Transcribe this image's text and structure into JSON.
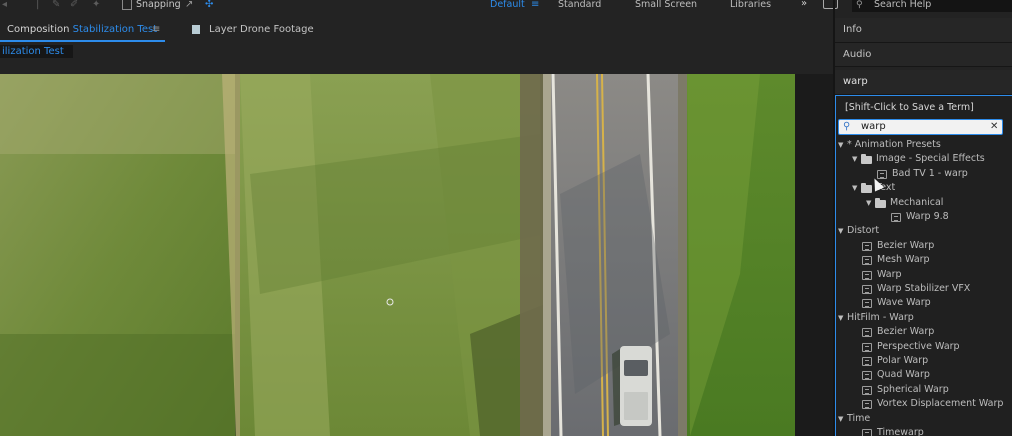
{
  "toolbar": {
    "snapping_label": "Snapping",
    "workspaces": [
      "Default",
      "Standard",
      "Small Screen",
      "Libraries"
    ],
    "active_workspace": "Default",
    "overflow_label": "»",
    "search_placeholder": "Search Help"
  },
  "composition": {
    "tab_prefix": "Composition",
    "tab_name": "Stabilization Test",
    "breadcrumb": "ilization Test",
    "layer_tab": "Layer Drone Footage"
  },
  "right_panel": {
    "info_label": "Info",
    "audio_label": "Audio",
    "effects_title": "warp",
    "save_term_label": "[Shift-Click to Save a Term]",
    "search_value": "warp",
    "tree": [
      {
        "label": "* Animation Presets",
        "type": "category"
      },
      {
        "label": "Image - Special Effects",
        "type": "folder"
      },
      {
        "label": "Bad TV 1 - warp",
        "type": "effect"
      },
      {
        "label": "Text",
        "type": "folder"
      },
      {
        "label": "Mechanical",
        "type": "folder"
      },
      {
        "label": "Warp 9.8",
        "type": "effect"
      },
      {
        "label": "Distort",
        "type": "category"
      },
      {
        "label": "Bezier Warp",
        "type": "effect"
      },
      {
        "label": "Mesh Warp",
        "type": "effect"
      },
      {
        "label": "Warp",
        "type": "effect"
      },
      {
        "label": "Warp Stabilizer VFX",
        "type": "effect"
      },
      {
        "label": "Wave Warp",
        "type": "effect"
      },
      {
        "label": "HitFilm - Warp",
        "type": "category"
      },
      {
        "label": "Bezier Warp",
        "type": "effect"
      },
      {
        "label": "Perspective Warp",
        "type": "effect"
      },
      {
        "label": "Polar Warp",
        "type": "effect"
      },
      {
        "label": "Quad Warp",
        "type": "effect"
      },
      {
        "label": "Spherical Warp",
        "type": "effect"
      },
      {
        "label": "Vortex Displacement Warp",
        "type": "effect"
      },
      {
        "label": "Time",
        "type": "category"
      },
      {
        "label": "Timewarp",
        "type": "effect"
      }
    ]
  },
  "colors": {
    "accent": "#2d8ceb",
    "panel_bg": "#232323"
  }
}
